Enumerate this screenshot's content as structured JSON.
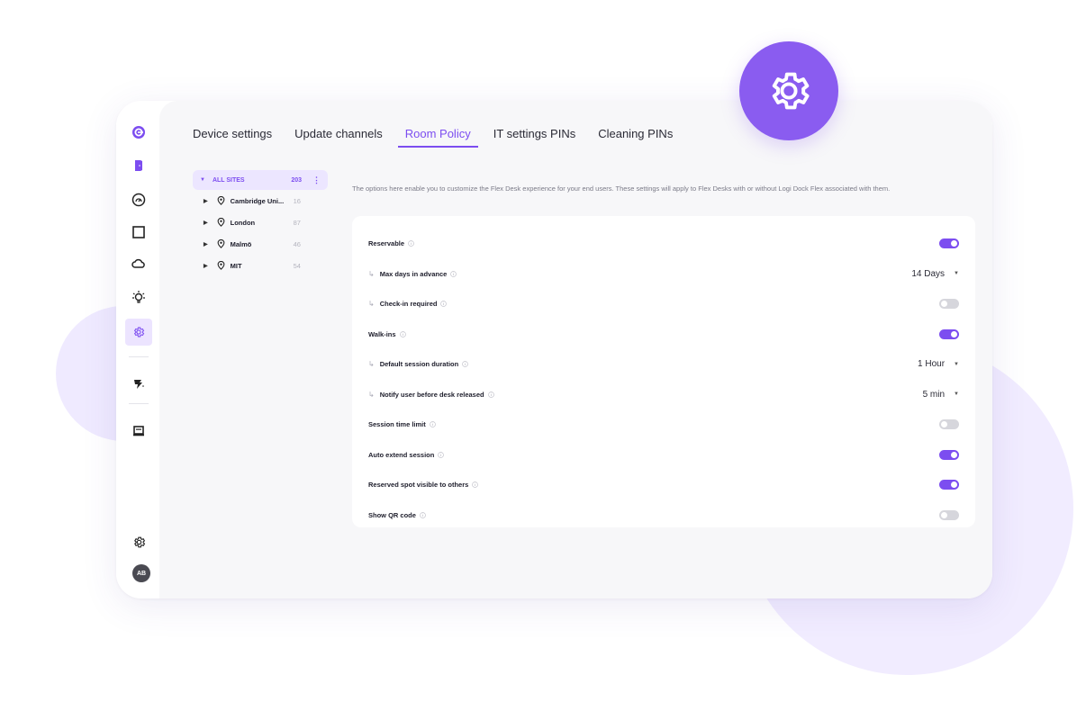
{
  "tabs": [
    {
      "label": "Device settings",
      "active": false
    },
    {
      "label": "Update channels",
      "active": false
    },
    {
      "label": "Room Policy",
      "active": true
    },
    {
      "label": "IT settings PINs",
      "active": false
    },
    {
      "label": "Cleaning PINs",
      "active": false
    }
  ],
  "sidebar": {
    "items": [
      {
        "icon": "logo-icon"
      },
      {
        "icon": "door-icon"
      },
      {
        "icon": "dashboard-icon"
      },
      {
        "icon": "room-icon"
      },
      {
        "icon": "cloud-icon"
      },
      {
        "icon": "insights-icon"
      },
      {
        "icon": "settings-icon",
        "active": true
      },
      {
        "icon": "scribe-icon"
      },
      {
        "icon": "desk-icon"
      },
      {
        "icon": "gear-icon"
      }
    ],
    "avatar": "AB"
  },
  "tree": {
    "root": {
      "label": "ALL SITES",
      "count": "203"
    },
    "sites": [
      {
        "name": "Cambridge Uni...",
        "count": "16"
      },
      {
        "name": "London",
        "count": "87"
      },
      {
        "name": "Malmö",
        "count": "46"
      },
      {
        "name": "MIT",
        "count": "54"
      }
    ]
  },
  "description": "The options here enable you to customize the Flex Desk experience for your end users. These settings will apply to Flex Desks with or without Logi Dock Flex associated with them.",
  "settings": [
    {
      "label": "Reservable",
      "sub": false,
      "control": "toggle",
      "on": true
    },
    {
      "label": "Max days in advance",
      "sub": true,
      "control": "select",
      "value": "14 Days"
    },
    {
      "label": "Check-in required",
      "sub": true,
      "control": "toggle",
      "on": false
    },
    {
      "label": "Walk-ins",
      "sub": false,
      "control": "toggle",
      "on": true
    },
    {
      "label": "Default session duration",
      "sub": true,
      "control": "select",
      "value": "1 Hour"
    },
    {
      "label": "Notify user before desk released",
      "sub": true,
      "control": "select",
      "value": "5 min"
    },
    {
      "label": "Session time limit",
      "sub": false,
      "control": "toggle",
      "on": false
    },
    {
      "label": "Auto extend session",
      "sub": false,
      "control": "toggle",
      "on": true
    },
    {
      "label": "Reserved spot visible to others",
      "sub": false,
      "control": "toggle",
      "on": true
    },
    {
      "label": "Show QR code",
      "sub": false,
      "control": "toggle",
      "on": false
    }
  ],
  "colors": {
    "accent": "#7c4df0",
    "badge": "#8a5cf0",
    "toggle_off": "#d6d6dc"
  }
}
